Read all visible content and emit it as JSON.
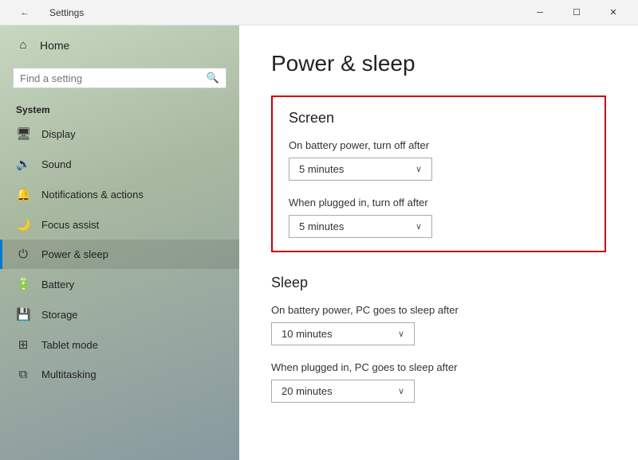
{
  "titleBar": {
    "title": "Settings",
    "minLabel": "─",
    "maxLabel": "☐",
    "closeLabel": "✕",
    "backLabel": "←"
  },
  "sidebar": {
    "home": "Home",
    "searchPlaceholder": "Find a setting",
    "searchIcon": "🔍",
    "systemLabel": "System",
    "items": [
      {
        "id": "display",
        "icon": "🖥",
        "label": "Display"
      },
      {
        "id": "sound",
        "icon": "🔊",
        "label": "Sound"
      },
      {
        "id": "notifications",
        "icon": "🔔",
        "label": "Notifications & actions"
      },
      {
        "id": "focus",
        "icon": "🌙",
        "label": "Focus assist"
      },
      {
        "id": "power",
        "icon": "⏻",
        "label": "Power & sleep",
        "active": true
      },
      {
        "id": "battery",
        "icon": "🔋",
        "label": "Battery"
      },
      {
        "id": "storage",
        "icon": "💾",
        "label": "Storage"
      },
      {
        "id": "tablet",
        "icon": "📱",
        "label": "Tablet mode"
      },
      {
        "id": "multitasking",
        "icon": "⧉",
        "label": "Multitasking"
      }
    ]
  },
  "content": {
    "pageTitle": "Power & sleep",
    "screenSection": {
      "title": "Screen",
      "batteryLabel": "On battery power, turn off after",
      "batteryValue": "5 minutes",
      "pluggedLabel": "When plugged in, turn off after",
      "pluggedValue": "5 minutes"
    },
    "sleepSection": {
      "title": "Sleep",
      "batteryLabel": "On battery power, PC goes to sleep after",
      "batteryValue": "10 minutes",
      "pluggedLabel": "When plugged in, PC goes to sleep after",
      "pluggedValue": "20 minutes"
    }
  }
}
